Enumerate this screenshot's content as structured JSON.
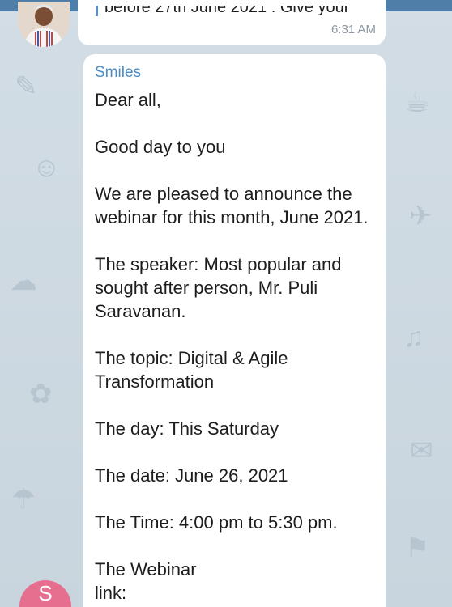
{
  "previous_message": {
    "quoted_text": "before 27th June 2021 : Give your",
    "time": "6:31 AM"
  },
  "message": {
    "sender": "Smiles",
    "paragraphs": [
      "Dear all,",
      "Good day to you",
      "We are pleased to announce the webinar for this month, June 2021.",
      "The speaker: Most popular and sought after person, Mr. Puli Saravanan.",
      "The topic: Digital & Agile Transformation",
      "The day: This Saturday",
      "The date: June 26, 2021",
      "The Time: 4:00 pm to 5:30 pm.",
      "The Webinar link:"
    ]
  },
  "bottom_avatar": {
    "initial": "S",
    "color": "#e66f90"
  },
  "colors": {
    "header": "#4f7fa8",
    "chat_background": "#cfdbe3",
    "sender_name": "#4b8dc3",
    "bubble": "#ffffff",
    "quote_bar": "#5b8fc4"
  }
}
